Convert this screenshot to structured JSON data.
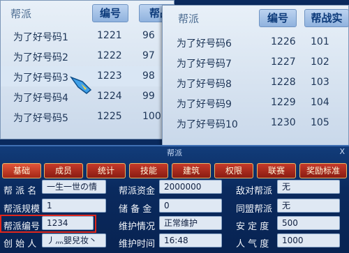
{
  "left_list": {
    "headers": {
      "name": "帮派",
      "number": "编号",
      "rank": "帮战"
    },
    "rows": [
      {
        "name": "为了好号码1",
        "number": "1221",
        "rank": "96"
      },
      {
        "name": "为了好号码2",
        "number": "1222",
        "rank": "97"
      },
      {
        "name": "为了好号码3",
        "number": "1223",
        "rank": "98"
      },
      {
        "name": "为了好号码4",
        "number": "1224",
        "rank": "99"
      },
      {
        "name": "为了好号码5",
        "number": "1225",
        "rank": "100"
      }
    ]
  },
  "right_list": {
    "headers": {
      "name": "帮派",
      "number": "编号",
      "rank": "帮战实"
    },
    "rows": [
      {
        "name": "为了好号码6",
        "number": "1226",
        "rank": "101"
      },
      {
        "name": "为了好号码7",
        "number": "1227",
        "rank": "102"
      },
      {
        "name": "为了好号码8",
        "number": "1228",
        "rank": "103"
      },
      {
        "name": "为了好号码9",
        "number": "1229",
        "rank": "104"
      },
      {
        "name": "为了好号码10",
        "number": "1230",
        "rank": "105"
      }
    ]
  },
  "guild": {
    "title": "帮派",
    "close": "X",
    "tabs": [
      "基础",
      "成员",
      "统计",
      "技能",
      "建筑",
      "权限",
      "联赛",
      "奖励标准"
    ],
    "fields": {
      "name": {
        "label": "帮 派 名",
        "value": "一生一世の情"
      },
      "scale": {
        "label": "帮派规模",
        "value": "1"
      },
      "number": {
        "label": "帮派编号",
        "value": "1234"
      },
      "founder": {
        "label": "创 始 人",
        "value": "丿灬嬰兒妆丶"
      },
      "funds": {
        "label": "帮派资金",
        "value": "2000000"
      },
      "reserve": {
        "label": "储 备 金",
        "value": "0"
      },
      "maintenance": {
        "label": "维护情况",
        "value": "正常维护"
      },
      "maint_time": {
        "label": "维护时间",
        "value": "16:48"
      },
      "enemy": {
        "label": "敌对帮派",
        "value": "无"
      },
      "ally": {
        "label": "同盟帮派",
        "value": "无"
      },
      "stability": {
        "label": "安 定 度",
        "value": "500"
      },
      "popularity": {
        "label": "人 气 度",
        "value": "1000"
      }
    }
  }
}
